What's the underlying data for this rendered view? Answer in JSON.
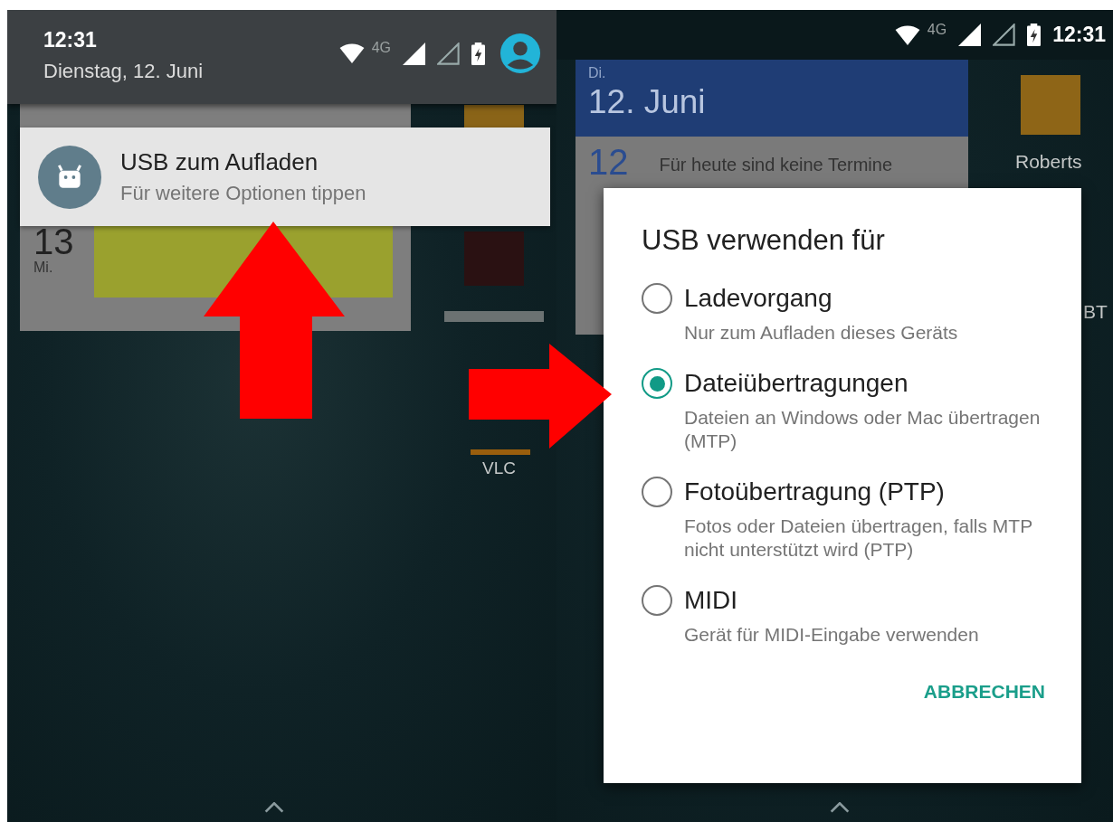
{
  "notification_shade": {
    "time": "12:31",
    "date": "Dienstag, 12. Juni",
    "network": "4G"
  },
  "notification": {
    "title": "USB zum Aufladen",
    "text": "Für weitere Optionen tippen"
  },
  "left_home": {
    "calendar": {
      "day_number": "13",
      "weekday": "Mi."
    },
    "app_label": "VLC"
  },
  "status_bar": {
    "network": "4G",
    "time": "12:31"
  },
  "right_home": {
    "calendar": {
      "weekday": "Di.",
      "date": "12. Juni",
      "row_day": "12",
      "row_text": "Für heute sind keine Termine"
    },
    "app_labels": [
      "Roberts",
      "BT"
    ]
  },
  "dialog": {
    "title": "USB verwenden für",
    "options": [
      {
        "label": "Ladevorgang",
        "description": "Nur zum Aufladen dieses Geräts",
        "selected": false
      },
      {
        "label": "Dateiübertragungen",
        "description": "Dateien an Windows oder Mac übertragen (MTP)",
        "selected": true
      },
      {
        "label": "Fotoübertragung (PTP)",
        "description": "Fotos oder Dateien übertragen, falls MTP nicht unterstützt wird (PTP)",
        "selected": false
      },
      {
        "label": "MIDI",
        "description": "Gerät für MIDI-Eingabe verwenden",
        "selected": false
      }
    ],
    "button": "ABBRECHEN"
  }
}
